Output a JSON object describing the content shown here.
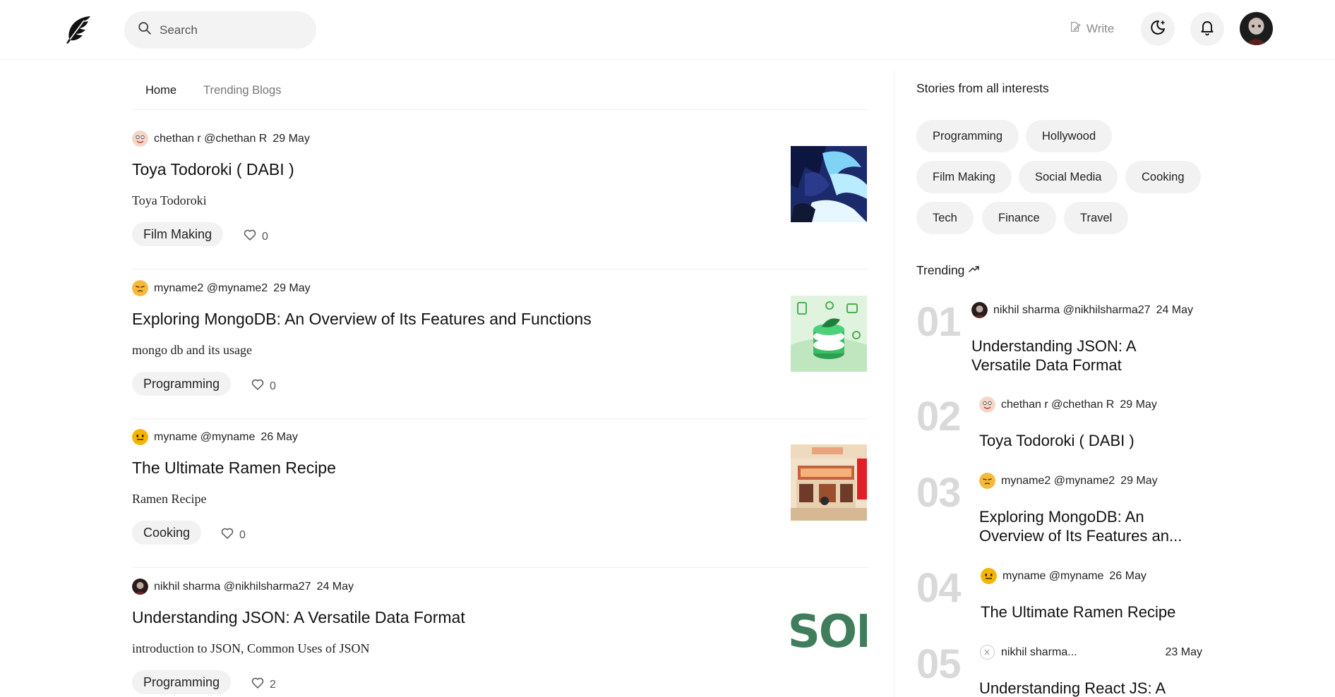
{
  "header": {
    "logo_icon": "feather-logo-icon",
    "search_placeholder": "Search",
    "write_label": "Write",
    "theme_icon": "moon-icon",
    "notification_icon": "bell-icon"
  },
  "tabs": [
    {
      "label": "Home",
      "active": true
    },
    {
      "label": "Trending Blogs",
      "active": false
    }
  ],
  "posts": [
    {
      "author": "chethan r @chethan R",
      "date": "29 May",
      "title": "Toya Todoroki ( DABI )",
      "description": "Toya Todoroki",
      "tag": "Film Making",
      "likes": "0"
    },
    {
      "author": "myname2 @myname2",
      "date": "29 May",
      "title": "Exploring MongoDB: An Overview of Its Features and Functions",
      "description": "mongo db and its usage",
      "tag": "Programming",
      "likes": "0"
    },
    {
      "author": "myname @myname",
      "date": "26 May",
      "title": "The Ultimate Ramen Recipe",
      "description": "Ramen Recipe",
      "tag": "Cooking",
      "likes": "0"
    },
    {
      "author": "nikhil sharma @nikhilsharma27",
      "date": "24 May",
      "title": "Understanding JSON: A Versatile Data Format",
      "description": "introduction to JSON, Common Uses of JSON",
      "tag": "Programming",
      "likes": "2",
      "thumb_text": "SOI"
    }
  ],
  "sidebar": {
    "interests_heading": "Stories from all interests",
    "interests": [
      "Programming",
      "Hollywood",
      "Film Making",
      "Social Media",
      "Cooking",
      "Tech",
      "Finance",
      "Travel"
    ],
    "trending_heading": "Trending",
    "trending": [
      {
        "rank": "01",
        "author": "nikhil sharma @nikhilsharma27",
        "date": "24 May",
        "title": "Understanding JSON: A Versatile Data Format"
      },
      {
        "rank": "02",
        "author": "chethan r @chethan R",
        "date": "29 May",
        "title": "Toya Todoroki ( DABI )"
      },
      {
        "rank": "03",
        "author": "myname2 @myname2",
        "date": "29 May",
        "title": "Exploring MongoDB: An Overview of Its Features an..."
      },
      {
        "rank": "04",
        "author": "myname @myname",
        "date": "26 May",
        "title": "The Ultimate Ramen Recipe"
      },
      {
        "rank": "05",
        "author": "nikhil sharma...",
        "date": "23 May",
        "title": "Understanding React JS: A"
      }
    ]
  },
  "colors": {
    "chip_bg": "#f2f2f2",
    "rank_gray": "#d9d9d9",
    "json_green": "#3f7d5c"
  }
}
